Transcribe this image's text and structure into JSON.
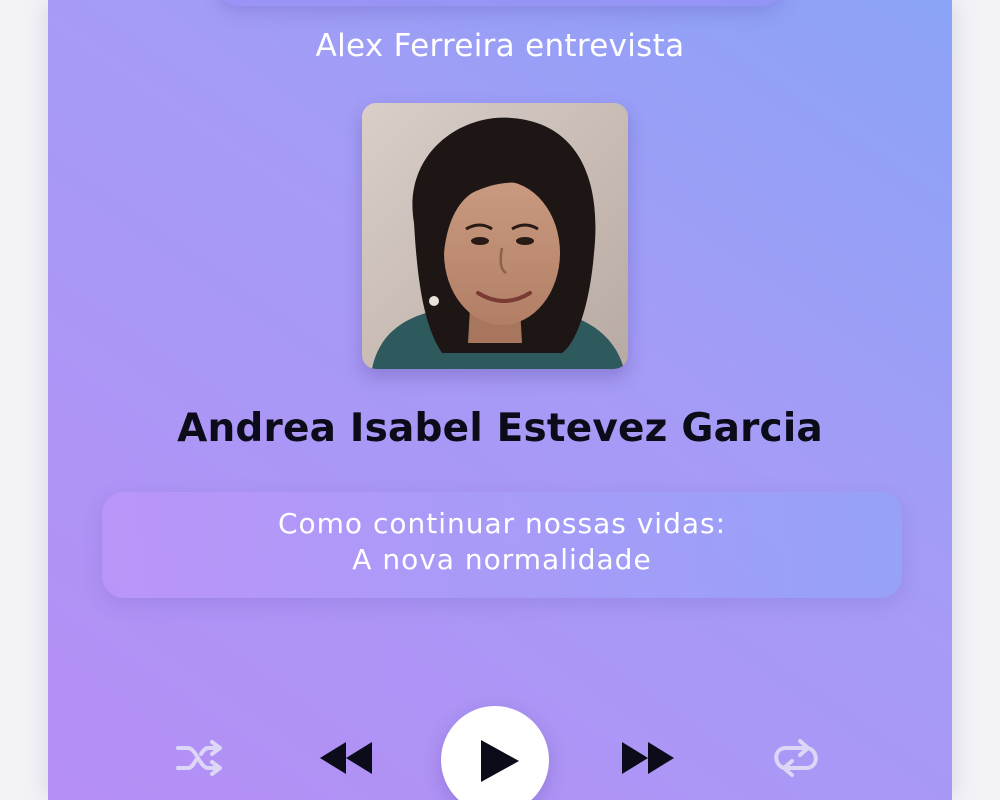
{
  "episode": {
    "host_line": "Alex Ferreira entrevista",
    "guest_name": "Andrea Isabel Estevez Garcia",
    "topic_line1": "Como continuar nossas vidas:",
    "topic_line2": "A nova normalidade"
  },
  "controls": {
    "shuffle_icon": "shuffle-icon",
    "rewind_icon": "rewind-icon",
    "play_icon": "play-icon",
    "forward_icon": "fast-forward-icon",
    "repeat_icon": "repeat-icon"
  },
  "colors": {
    "background_gradient_start": "#b58ef5",
    "background_gradient_end": "#8aa3f7",
    "text_primary": "#0b0b1a",
    "text_light": "#ffffff",
    "control_muted": "#dcd6f7"
  }
}
